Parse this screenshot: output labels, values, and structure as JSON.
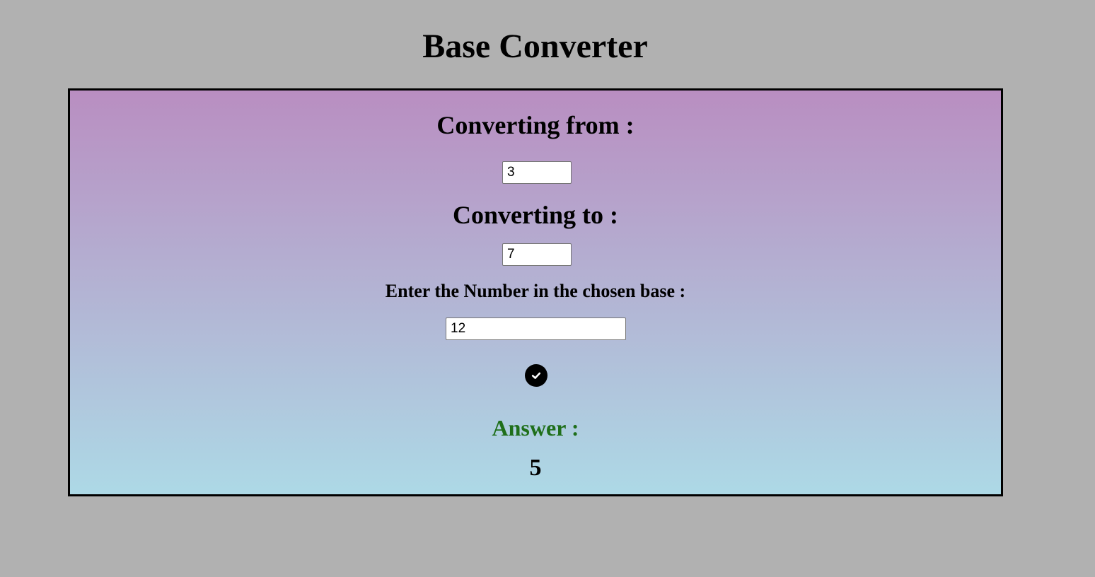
{
  "header": {
    "title": "Base Converter"
  },
  "form": {
    "from_label": "Converting from :",
    "from_value": "3",
    "to_label": "Converting to :",
    "to_value": "7",
    "number_label": "Enter the Number in the chosen base :",
    "number_value": "12",
    "submit_icon": "check-circle-icon"
  },
  "result": {
    "answer_label": "Answer :",
    "answer_value": "5"
  },
  "colors": {
    "page_background": "#b1b1b1",
    "gradient_top": "#b98ec1",
    "gradient_bottom": "#add9e6",
    "answer_label": "#1f6f1a"
  }
}
